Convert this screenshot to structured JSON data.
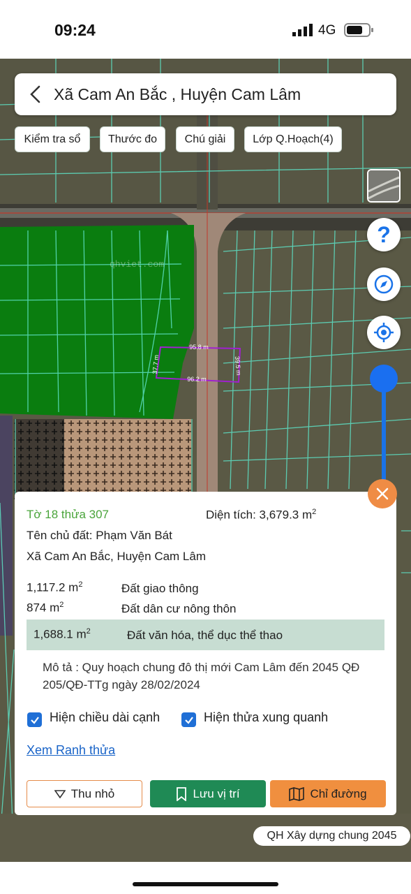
{
  "status_bar": {
    "time": "09:24",
    "network": "4G"
  },
  "header": {
    "title": "Xã Cam An Bắc , Huyện Cam Lâm"
  },
  "chips": [
    "Kiểm tra sổ",
    "Thước đo",
    "Chú giải",
    "Lớp Q.Hoạch(4)"
  ],
  "map": {
    "watermark": "qhviet.com",
    "dimensions": {
      "top": "95.8 m",
      "bottom": "96.2 m",
      "left": "37.7 m",
      "right": "39.5 m"
    },
    "plan_label": "QH Xây dựng chung 2045"
  },
  "info": {
    "sheet": "Tờ 18 thửa 307",
    "area_label": "Diện tích: 3,679.3 m",
    "area_sup": "2",
    "owner": "Tên chủ đất: Phạm Văn Bát",
    "address": "Xã Cam An Bắc, Huyện Cam Lâm",
    "land_uses": [
      {
        "area": "1,117.2 m",
        "sup": "2",
        "type": "Đất giao thông"
      },
      {
        "area": "874 m",
        "sup": "2",
        "type": "Đất dân cư nông thôn"
      },
      {
        "area": "1,688.1 m",
        "sup": "2",
        "type": "Đất văn hóa, thể dục thể thao"
      }
    ],
    "description": "Mô tả : Quy hoạch chung đô thị mới Cam Lâm đến 2045 QĐ 205/QĐ-TTg ngày 28/02/2024",
    "checkbox_edges": "Hiện chiều dài cạnh",
    "checkbox_neighbors": "Hiện thửa xung quanh",
    "link_boundary": "Xem Ranh thửa",
    "btn_minimize": "Thu nhỏ",
    "btn_save": "Lưu vị trí",
    "btn_directions": "Chỉ đường"
  },
  "colors": {
    "accent_green": "#1f8a55",
    "accent_orange": "#f08f3f",
    "blue": "#1a6ff0",
    "plot_green": "#4aa43b"
  }
}
